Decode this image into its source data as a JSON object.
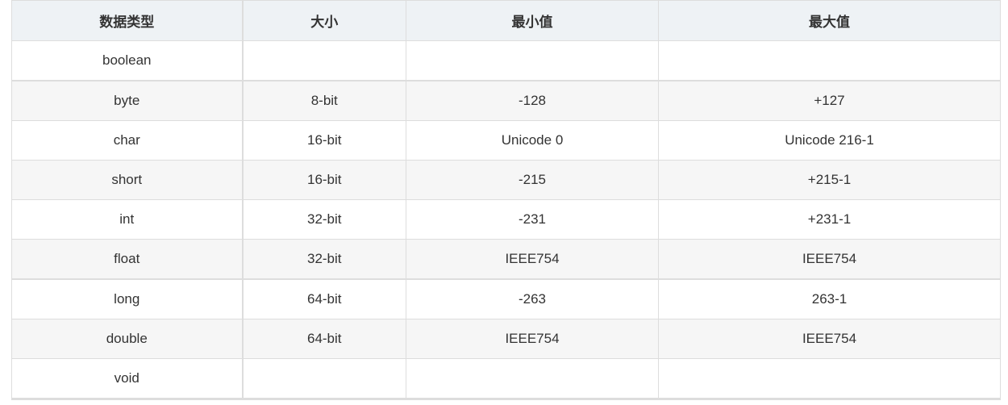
{
  "table": {
    "headers": [
      "数据类型",
      "大小",
      "最小值",
      "最大值"
    ],
    "rows": [
      {
        "type": "boolean",
        "size": "",
        "min": "",
        "max": ""
      },
      {
        "type": "byte",
        "size": "8-bit",
        "min": "-128",
        "max": "+127"
      },
      {
        "type": "char",
        "size": "16-bit",
        "min": "Unicode 0",
        "max": "Unicode 216-1"
      },
      {
        "type": "short",
        "size": "16-bit",
        "min": "-215",
        "max": "+215-1"
      },
      {
        "type": "int",
        "size": "32-bit",
        "min": "-231",
        "max": "+231-1"
      },
      {
        "type": "float",
        "size": "32-bit",
        "min": "IEEE754",
        "max": "IEEE754"
      },
      {
        "type": "long",
        "size": "64-bit",
        "min": "-263",
        "max": "263-1"
      },
      {
        "type": "double",
        "size": "64-bit",
        "min": "IEEE754",
        "max": "IEEE754"
      },
      {
        "type": "void",
        "size": "",
        "min": "",
        "max": ""
      }
    ]
  },
  "colors": {
    "header_bg": "#eef2f5",
    "stripe_bg": "#f6f6f6",
    "border": "#dddddd",
    "text": "#333333"
  }
}
